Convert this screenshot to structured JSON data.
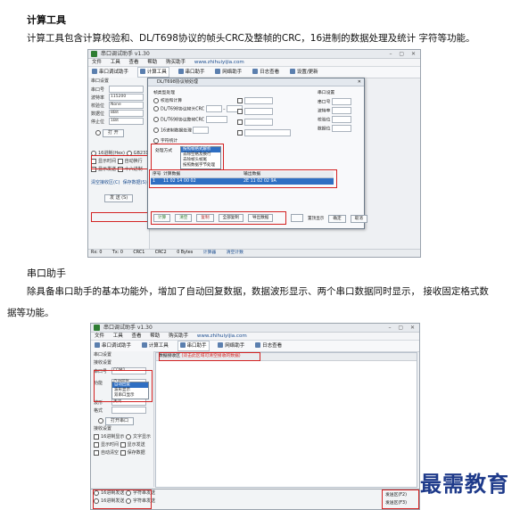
{
  "section1": {
    "heading": "计算工具",
    "paragraph": "计算工具包含计算校验和、DL/T698协议的帧头CRC及整帧的CRC，16进制的数据处理及统计 字符等功能。"
  },
  "shot1": {
    "window_title": "串口调试助手 v1.30",
    "menu": [
      "文件",
      "工具",
      "查看",
      "帮助",
      "购买助手",
      "www.zhihuiyijia.com"
    ],
    "toolbar": [
      "串口调试助手",
      "计算工具",
      "串口助手",
      "网络助手",
      "日志查看",
      "设置/更新"
    ],
    "sidebar": {
      "section_label": "串口设置",
      "rows": [
        {
          "label": "串口号",
          "value": ""
        },
        {
          "label": "波特率",
          "value": "115200"
        },
        {
          "label": "校验位",
          "value": "None"
        },
        {
          "label": "数据位",
          "value": "8Bit"
        },
        {
          "label": "停止位",
          "value": "1Bit"
        }
      ],
      "open_button": "打 开",
      "charset_options": [
        "16进制(Hex)",
        "GB2312"
      ],
      "checkboxes": [
        "显示时间",
        "自动换行",
        "显示发送",
        "十六进制"
      ],
      "links": [
        "清空接收区(C)",
        "保存数据(S)"
      ],
      "send_button": "发 送 (S)"
    },
    "dialog": {
      "title": "DL/T698协议帧处理",
      "left_group": "帧类型处理",
      "options": [
        "校验和计算",
        "DL/T698协议帧头CRC",
        "DL/T698协议整帧CRC",
        "16进制数据处理",
        "字符统计"
      ],
      "dropdown_label": "处理方式",
      "dropdown_items": [
        "按照帧格式解析",
        "去除空格及换行",
        "去除帧头帧尾",
        "按照数据字节处理"
      ],
      "right_group": "串口设置",
      "right_labels": [
        "串口号",
        "波特率",
        "校验位",
        "数据位"
      ],
      "table_headers": [
        "序号",
        "计算数据",
        "输出数据"
      ],
      "table_row": [
        "1",
        "11 02 14 00 02",
        "2E 11 02 02 9A"
      ],
      "buttons": [
        "计算",
        "清空",
        "复制",
        "全部复制",
        "导出数据"
      ],
      "bottom_buttons": [
        "确定",
        "取消"
      ],
      "bottom_check": "置顶显示"
    },
    "status": [
      "Rx: 0",
      "Tx: 0",
      "CRC1",
      "CRC2",
      "0 Bytes",
      "计算器",
      "清空计数"
    ]
  },
  "section2": {
    "heading": "串口助手",
    "paragraph_line1": "除具备串口助手的基本功能外，增加了自动回复数据，数据波形显示、两个串口数据同时显示， 接收固定格式数",
    "paragraph_line2": "据等功能。"
  },
  "shot2": {
    "window_title": "串口调试助手 v1.30",
    "menu": [
      "文件",
      "工具",
      "查看",
      "帮助",
      "购买助手",
      "www.zhihuiyijia.com"
    ],
    "toolbar": [
      "串口调试助手",
      "计算工具",
      "串口助手",
      "网络助手",
      "日志查看"
    ],
    "sidebar": {
      "section_label": "串口设置",
      "sub_label": "接收设置",
      "rows": [
        {
          "label": "串口号",
          "value": "COM1"
        },
        {
          "label": "功能",
          "value": "自动回复"
        },
        {
          "label": "波形",
          "value": "关闭"
        },
        {
          "label": "格式",
          "value": ""
        }
      ],
      "dropdown_items": [
        "自动回复",
        "波形显示",
        "双串口显示"
      ],
      "open_button": "打开串口",
      "receive_label": "接收设置",
      "checkboxes": [
        "16进制显示",
        "文字显示",
        "显示时间",
        "显示发送",
        "自动清空",
        "保存数据"
      ]
    },
    "pane_title": "数据接收区",
    "pane_note": "(双击此区域可清空接收的数据)",
    "bottom_rows": [
      "16进制发送",
      "字符串发送"
    ],
    "bottom_right": [
      "发送区(F2)",
      "发送区(F3)"
    ]
  },
  "watermark": "最需教育",
  "colors": {
    "highlight_red": "#d32222",
    "select_blue": "#2f6fc3",
    "watermark_blue": "#1e3a8a"
  }
}
